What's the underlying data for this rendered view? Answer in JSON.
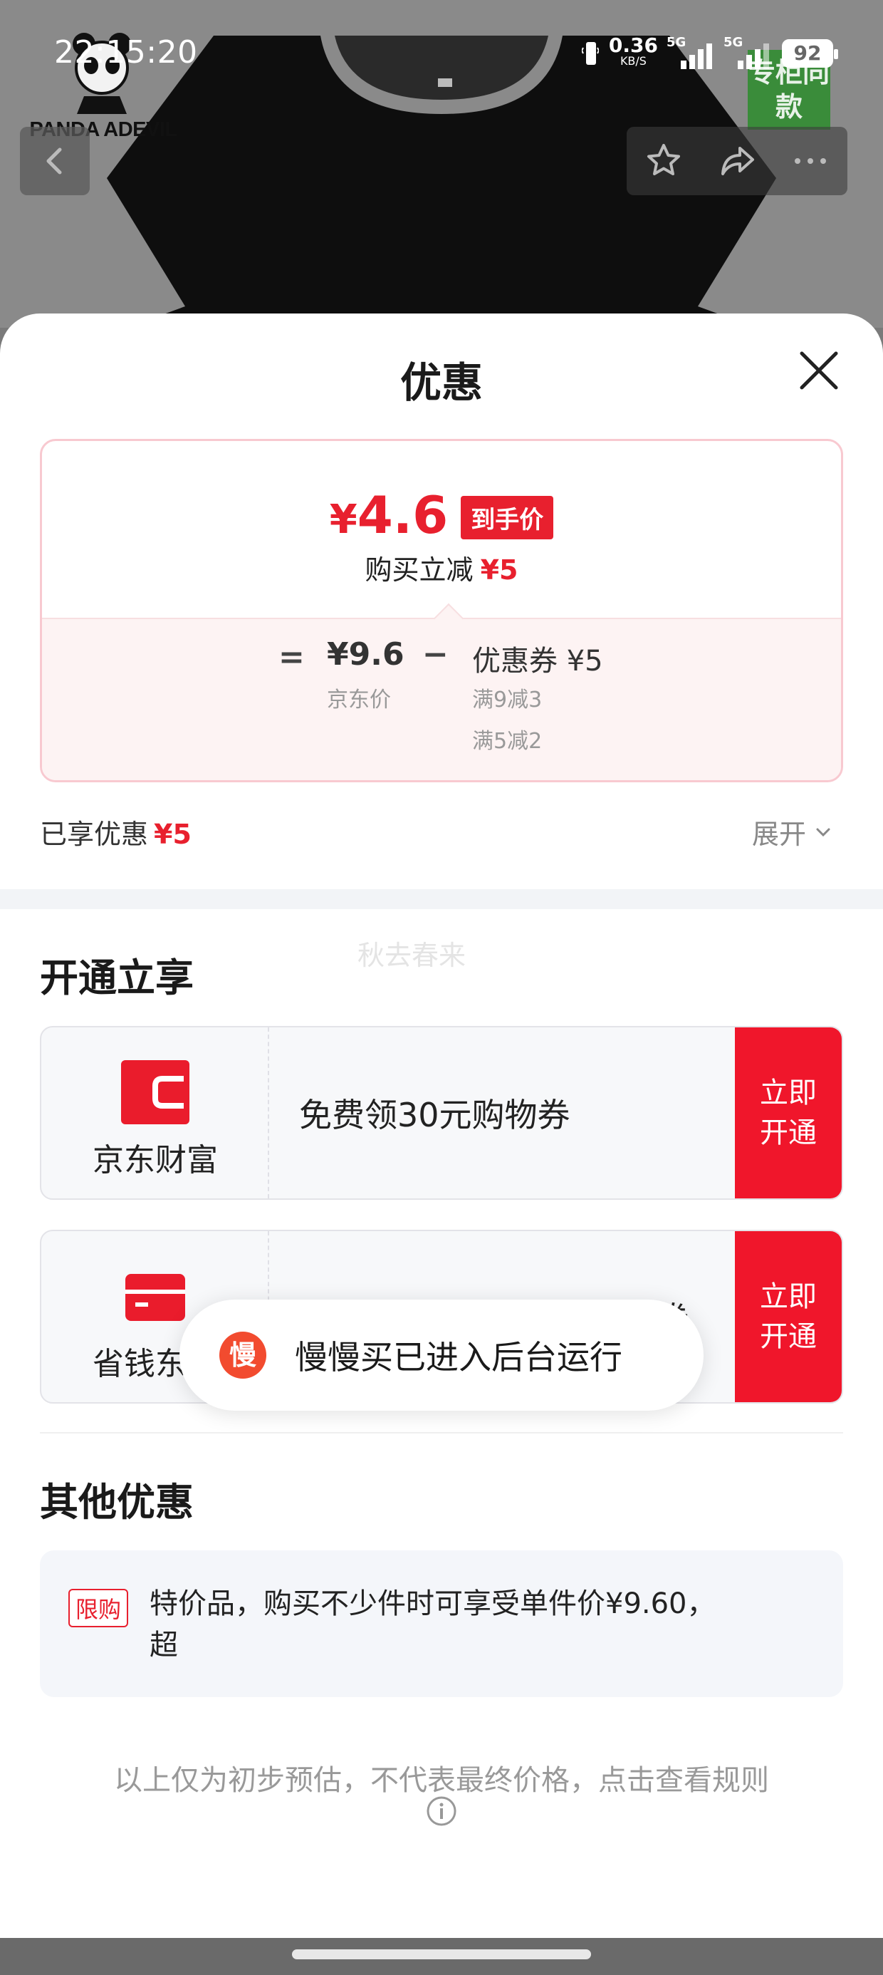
{
  "status_bar": {
    "time": "22:15:20",
    "net_speed": "0.36",
    "net_unit": "KB/S",
    "signal1_label": "5G",
    "signal2_label": "5G",
    "battery": "92"
  },
  "product_bg": {
    "brand": "PANDA ADEVIL",
    "badge": "专柜同款"
  },
  "sheet": {
    "title": "优惠",
    "price_card": {
      "currency": "¥",
      "final_price": "4.6",
      "final_tag": "到手价",
      "instant_label": "购买立减",
      "instant_value": "¥5",
      "equals": "=",
      "jd_price": "¥9.6",
      "jd_label": "京东价",
      "minus": "−",
      "coupon_label": "优惠券 ¥5",
      "coupon_rule1": "满9减3",
      "coupon_rule2": "满5减2"
    },
    "enjoyed_label": "已享优惠",
    "enjoyed_value": "¥5",
    "expand_label": "展开",
    "watermark": "秋去春来",
    "open_section_title": "开通立享",
    "offers": [
      {
        "name": "京东财富",
        "text": "免费领30元购物券",
        "button": "立即\n开通",
        "icon": "jd-finance-icon"
      },
      {
        "name": "省钱东卡",
        "text": "免费领100元无门槛立减券",
        "button": "立即\n开通",
        "icon": "card-icon"
      }
    ],
    "other_section_title": "其他优惠",
    "limit_tag": "限购",
    "limit_text_line1": "特价品，购买不少件时可享受单件价¥9.60，",
    "limit_text_line2": "超",
    "toast": {
      "icon_text": "慢",
      "message": "慢慢买已进入后台运行"
    },
    "disclaimer": "以上仅为初步预估，不代表最终价格，点击查看规则"
  },
  "colors": {
    "accent_red": "#e8202e",
    "button_red": "#f0162b",
    "toast_orange": "#f24b2f"
  }
}
